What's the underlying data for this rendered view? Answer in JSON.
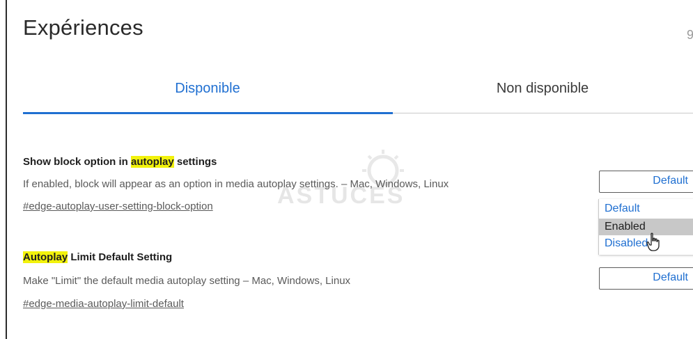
{
  "header": {
    "title": "Expériences",
    "cut_char": "9"
  },
  "tabs": [
    {
      "label": "Disponible"
    },
    {
      "label": "Non disponible"
    }
  ],
  "watermark": {
    "text": "ASTUCES"
  },
  "experiments": [
    {
      "title_before": "Show block option in ",
      "title_highlight": "autoplay",
      "title_after": " settings",
      "description": "If enabled, block will appear as an option in media autoplay settings. – Mac, Windows, Linux",
      "link": "#edge-autoplay-user-setting-block-option",
      "select_value": "Default",
      "options": [
        "Default",
        "Enabled",
        "Disabled"
      ],
      "hovered_option": "Enabled"
    },
    {
      "title_before": "",
      "title_highlight": "Autoplay",
      "title_after": " Limit Default Setting",
      "description": "Make \"Limit\" the default media autoplay setting – Mac, Windows, Linux",
      "link": "#edge-media-autoplay-limit-default",
      "select_value": "Default"
    }
  ],
  "colors": {
    "accent": "#1f6fd1",
    "highlight": "#f2f20c",
    "hover": "#c8c8c8"
  }
}
